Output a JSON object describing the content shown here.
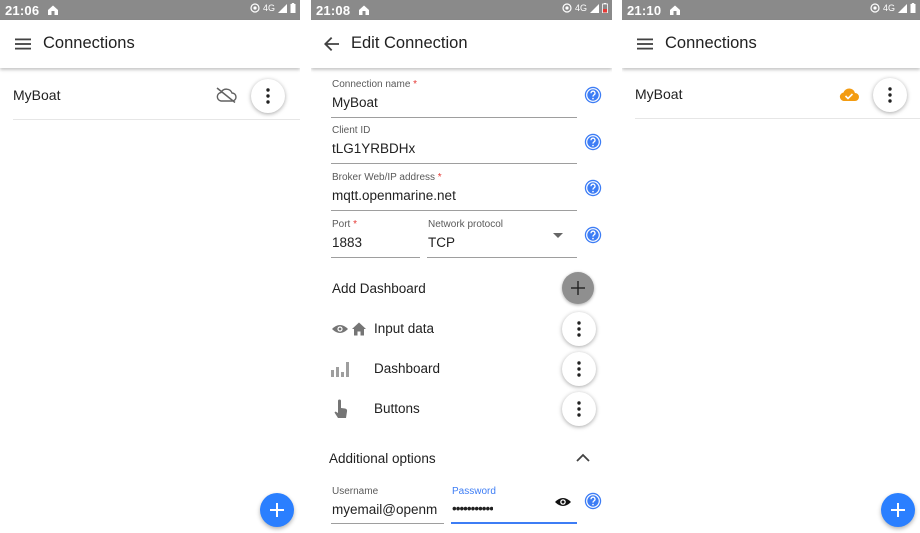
{
  "screen1": {
    "status_time": "21:06",
    "status_network": "4G",
    "title": "Connections",
    "connection": {
      "name": "MyBoat",
      "cloud_state": "cloud-off-icon"
    }
  },
  "screen2": {
    "status_time": "21:08",
    "status_network": "4G",
    "title": "Edit Connection",
    "fields": {
      "connection_name": {
        "label": "Connection name",
        "required": "*",
        "value": "MyBoat"
      },
      "client_id": {
        "label": "Client ID",
        "value": "tLG1YRBDHx"
      },
      "broker": {
        "label": "Broker Web/IP address",
        "required": "*",
        "value": "mqtt.openmarine.net"
      },
      "port": {
        "label": "Port",
        "required": "*",
        "value": "1883"
      },
      "protocol": {
        "label": "Network protocol",
        "value": "TCP"
      }
    },
    "add_dashboard_label": "Add Dashboard",
    "dashboards": [
      {
        "label": "Input data",
        "icon": "eye-home-icon"
      },
      {
        "label": "Dashboard",
        "icon": "bar-chart-icon"
      },
      {
        "label": "Buttons",
        "icon": "touch-icon"
      }
    ],
    "additional_options_label": "Additional options",
    "username": {
      "label": "Username",
      "value": "myemail@openm"
    },
    "password": {
      "label": "Password",
      "value": "•••••••••••"
    },
    "colors": {
      "accent": "#3d7df5",
      "required": "#e53935"
    }
  },
  "screen3": {
    "status_time": "21:10",
    "status_network": "4G",
    "title": "Connections",
    "connection": {
      "name": "MyBoat",
      "cloud_state": "cloud-done-icon"
    },
    "colors": {
      "cloud_done": "#f39c12"
    }
  }
}
